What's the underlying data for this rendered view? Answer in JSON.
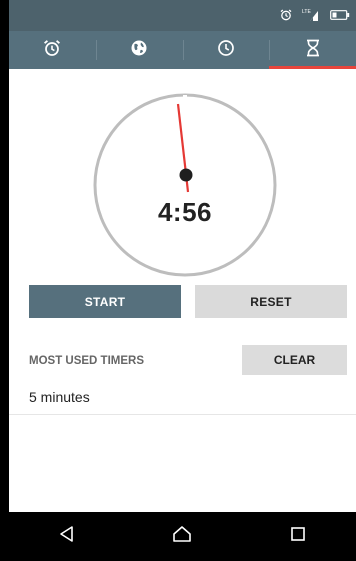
{
  "status_bar": {
    "icons": [
      "alarm-icon",
      "lte-signal-icon",
      "battery-icon"
    ],
    "network_label": "LTE"
  },
  "tabs": [
    {
      "name": "alarm",
      "icon": "alarm-clock-icon",
      "active": false
    },
    {
      "name": "world-clock",
      "icon": "globe-icon",
      "active": false
    },
    {
      "name": "stopwatch",
      "icon": "clock-icon",
      "active": false
    },
    {
      "name": "timer",
      "icon": "hourglass-icon",
      "active": true
    }
  ],
  "timer": {
    "display": "4:56",
    "remaining_seconds": 296
  },
  "controls": {
    "start_label": "START",
    "reset_label": "RESET"
  },
  "most_used": {
    "title": "MOST USED TIMERS",
    "clear_label": "CLEAR",
    "items": [
      "5 minutes"
    ]
  },
  "nav": {
    "icons": [
      "back-icon",
      "home-icon",
      "recents-icon"
    ]
  },
  "colors": {
    "status_bar": "#4d626c",
    "tab_bar": "#56707d",
    "accent": "#e8453c",
    "start_button": "#56707d",
    "secondary_button": "#dadada"
  }
}
